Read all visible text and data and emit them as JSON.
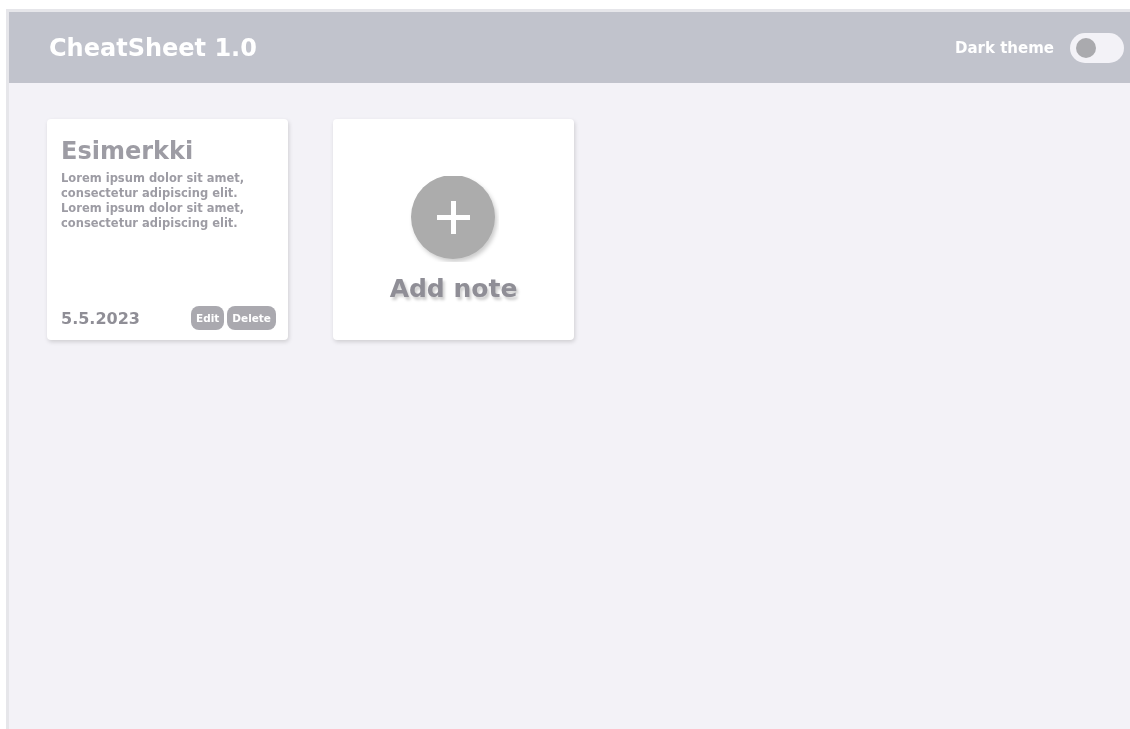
{
  "header": {
    "title": "CheatSheet 1.0",
    "theme_toggle": {
      "label": "Dark theme",
      "on": false
    }
  },
  "notes": [
    {
      "title": "Esimerkki",
      "body": "Lorem ipsum dolor sit amet, consectetur adipiscing elit. Lorem ipsum dolor sit amet, consectetur adipiscing elit.",
      "date": "5.5.2023",
      "buttons": [
        "Edit",
        "Delete"
      ]
    }
  ],
  "add_card": {
    "label": "Add note"
  }
}
